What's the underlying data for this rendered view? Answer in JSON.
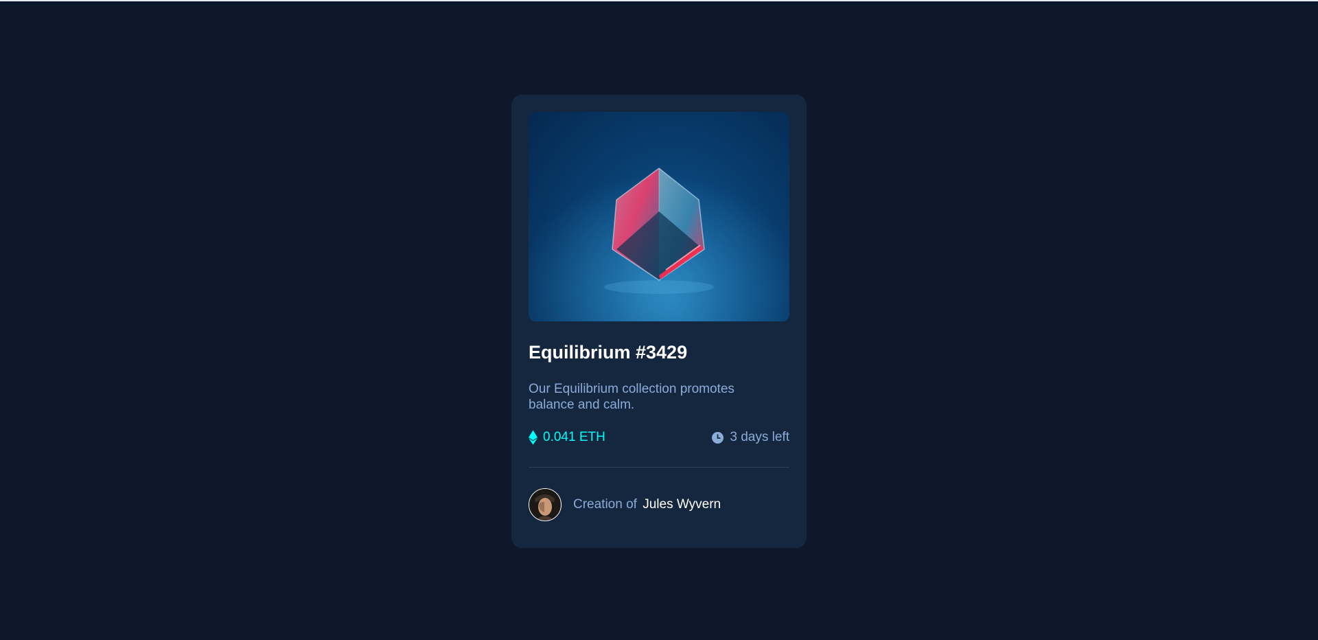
{
  "card": {
    "title": "Equilibrium #3429",
    "description": "Our Equilibrium collection promotes balance and calm.",
    "price": "0.041 ETH",
    "time_left": "3 days left",
    "creator_prefix": "Creation of",
    "creator_name": "Jules Wyvern"
  },
  "colors": {
    "page_bg": "#0d192b",
    "card_bg": "#15263f",
    "accent_cyan": "#00fff8",
    "soft_blue": "#8bacd9",
    "white": "#ffffff",
    "divider": "#2e405a"
  },
  "icons": {
    "price": "ethereum-icon",
    "time": "clock-icon"
  }
}
